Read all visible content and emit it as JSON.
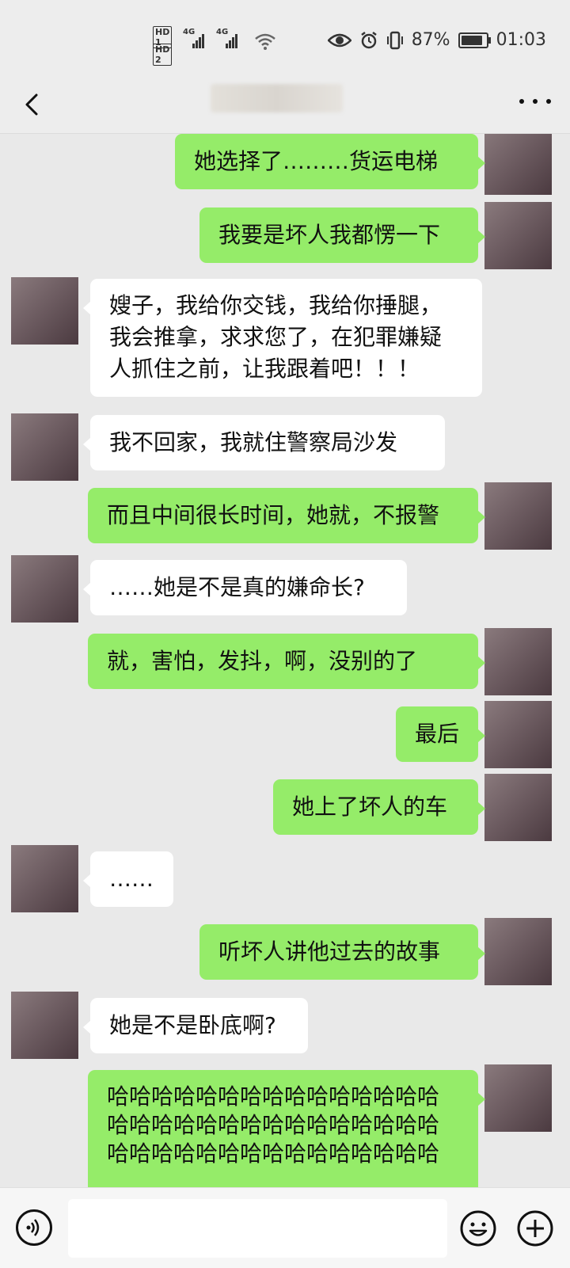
{
  "status_bar": {
    "hd1": "HD 1",
    "hd2": "HD 2",
    "net1": "4G",
    "net2": "4G",
    "battery_percent": "87%",
    "battery_level": 0.87,
    "time": "01:03"
  },
  "header": {
    "back_icon": "chevron-left-icon",
    "more_icon": "more-dots-icon"
  },
  "messages": [
    {
      "side": "me",
      "text": "她选择了………货运电梯"
    },
    {
      "side": "me",
      "text": "我要是坏人我都愣一下"
    },
    {
      "side": "other",
      "text": "嫂子，我给你交钱，我给你捶腿，我会推拿，求求您了，在犯罪嫌疑人抓住之前，让我跟着吧！！！"
    },
    {
      "side": "other",
      "text": "我不回家，我就住警察局沙发"
    },
    {
      "side": "me",
      "text": "而且中间很长时间，她就，不报警"
    },
    {
      "side": "other",
      "text": "……她是不是真的嫌命长?"
    },
    {
      "side": "me",
      "text": "就，害怕，发抖，啊，没别的了"
    },
    {
      "side": "me",
      "text": "最后"
    },
    {
      "side": "me",
      "text": "她上了坏人的车"
    },
    {
      "side": "other",
      "text": "……"
    },
    {
      "side": "me",
      "text": "听坏人讲他过去的故事"
    },
    {
      "side": "other",
      "text": "她是不是卧底啊?"
    },
    {
      "side": "me",
      "text": "哈哈哈哈哈哈哈哈哈哈哈哈哈哈哈哈哈哈哈哈哈哈哈哈哈哈哈哈哈哈哈哈哈哈哈哈哈哈哈哈哈哈哈哈哈"
    }
  ],
  "input_bar": {
    "voice_icon": "voice-icon",
    "emoji_icon": "emoji-icon",
    "plus_icon": "plus-icon"
  },
  "colors": {
    "sent_bubble": "#95ec69",
    "received_bubble": "#ffffff",
    "chat_background": "#e9e9e9"
  }
}
